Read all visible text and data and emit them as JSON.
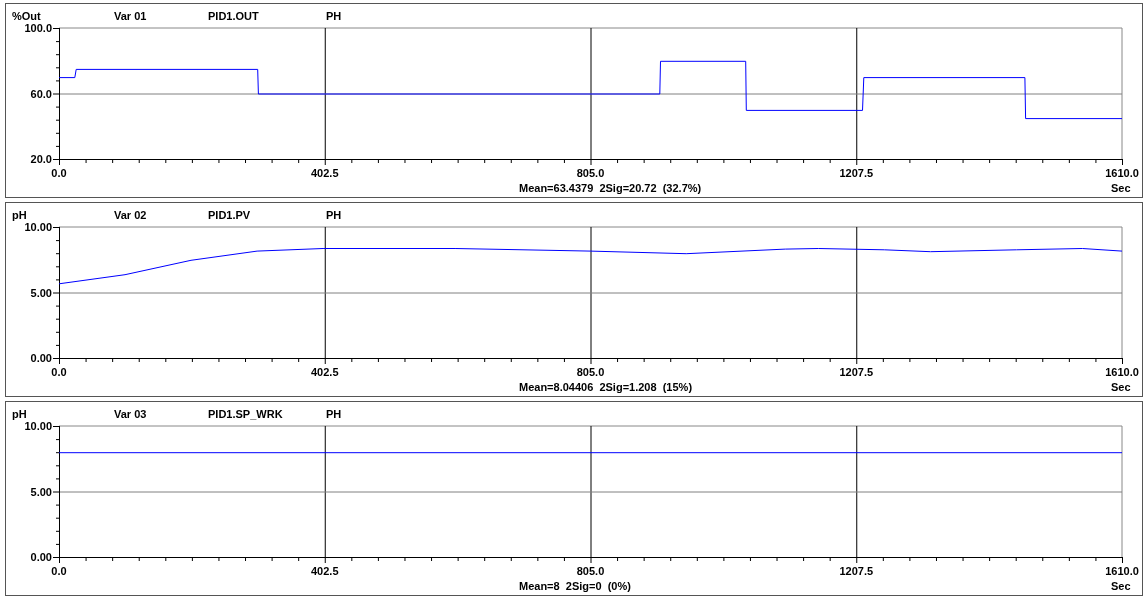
{
  "panels": [
    {
      "unit": "%Out",
      "variable": "Var 01",
      "tag": "PID1.OUT",
      "eng_unit": "PH",
      "statistics": "Mean=63.4379  2Sig=20.72  (32.7%)",
      "chart_data": {
        "type": "line",
        "xlabel": "Sec",
        "xlim": [
          0,
          1610
        ],
        "ylim": [
          20,
          100
        ],
        "xticks": [
          {
            "value": 0,
            "label": "0.0"
          },
          {
            "value": 402.5,
            "label": "402.5"
          },
          {
            "value": 805,
            "label": "805.0"
          },
          {
            "value": 1207.5,
            "label": "1207.5"
          },
          {
            "value": 1610,
            "label": "1610.0"
          }
        ],
        "yticks": [
          {
            "value": 20,
            "label": "20.0"
          },
          {
            "value": 60,
            "label": "60.0"
          },
          {
            "value": 100,
            "label": "100.0"
          }
        ],
        "x": [
          0,
          24,
          26,
          301,
          302,
          910,
          911,
          1040,
          1041,
          1217,
          1219,
          1463,
          1464,
          1610
        ],
        "grid": true,
        "ref_lines": [
          {
            "axis": "y",
            "value": 60,
            "color": "#808080"
          }
        ],
        "series": [
          {
            "color": "#0000ff",
            "values": [
              70,
              70,
              75,
              75,
              60,
              60,
              80,
              80,
              50,
              50,
              70,
              70,
              45,
              45
            ]
          }
        ]
      }
    },
    {
      "unit": "pH",
      "variable": "Var 02",
      "tag": "PID1.PV",
      "eng_unit": "PH",
      "statistics": "Mean=8.04406  2Sig=1.208  (15%)",
      "chart_data": {
        "type": "line",
        "xlabel": "Sec",
        "xlim": [
          0,
          1610
        ],
        "ylim": [
          0,
          10
        ],
        "xticks": [
          {
            "value": 0,
            "label": "0.0"
          },
          {
            "value": 402.5,
            "label": "402.5"
          },
          {
            "value": 805,
            "label": "805.0"
          },
          {
            "value": 1207.5,
            "label": "1207.5"
          },
          {
            "value": 1610,
            "label": "1610.0"
          }
        ],
        "yticks": [
          {
            "value": 0,
            "label": "0.00"
          },
          {
            "value": 5,
            "label": "5.00"
          },
          {
            "value": 10,
            "label": "10.00"
          }
        ],
        "x": [
          0,
          100,
          200,
          300,
          400,
          600,
          805,
          950,
          1100,
          1150,
          1250,
          1320,
          1450,
          1550,
          1610
        ],
        "grid": true,
        "ref_lines": [
          {
            "axis": "y",
            "value": 5,
            "color": "#808080"
          }
        ],
        "series": [
          {
            "color": "#0000ff",
            "values": [
              5.7,
              6.4,
              7.5,
              8.2,
              8.4,
              8.4,
              8.2,
              8.0,
              8.35,
              8.4,
              8.3,
              8.15,
              8.3,
              8.4,
              8.2
            ]
          }
        ]
      }
    },
    {
      "unit": "pH",
      "variable": "Var 03",
      "tag": "PID1.SP_WRK",
      "eng_unit": "PH",
      "statistics": "Mean=8  2Sig=0  (0%)",
      "chart_data": {
        "type": "line",
        "xlabel": "Sec",
        "xlim": [
          0,
          1610
        ],
        "ylim": [
          0,
          10
        ],
        "xticks": [
          {
            "value": 0,
            "label": "0.0"
          },
          {
            "value": 402.5,
            "label": "402.5"
          },
          {
            "value": 805,
            "label": "805.0"
          },
          {
            "value": 1207.5,
            "label": "1207.5"
          },
          {
            "value": 1610,
            "label": "1610.0"
          }
        ],
        "yticks": [
          {
            "value": 0,
            "label": "0.00"
          },
          {
            "value": 5,
            "label": "5.00"
          },
          {
            "value": 10,
            "label": "10.00"
          }
        ],
        "x": [
          0,
          1610
        ],
        "grid": true,
        "ref_lines": [
          {
            "axis": "y",
            "value": 5,
            "color": "#808080"
          }
        ],
        "series": [
          {
            "color": "#0000ff",
            "values": [
              8,
              8
            ]
          }
        ]
      }
    }
  ]
}
